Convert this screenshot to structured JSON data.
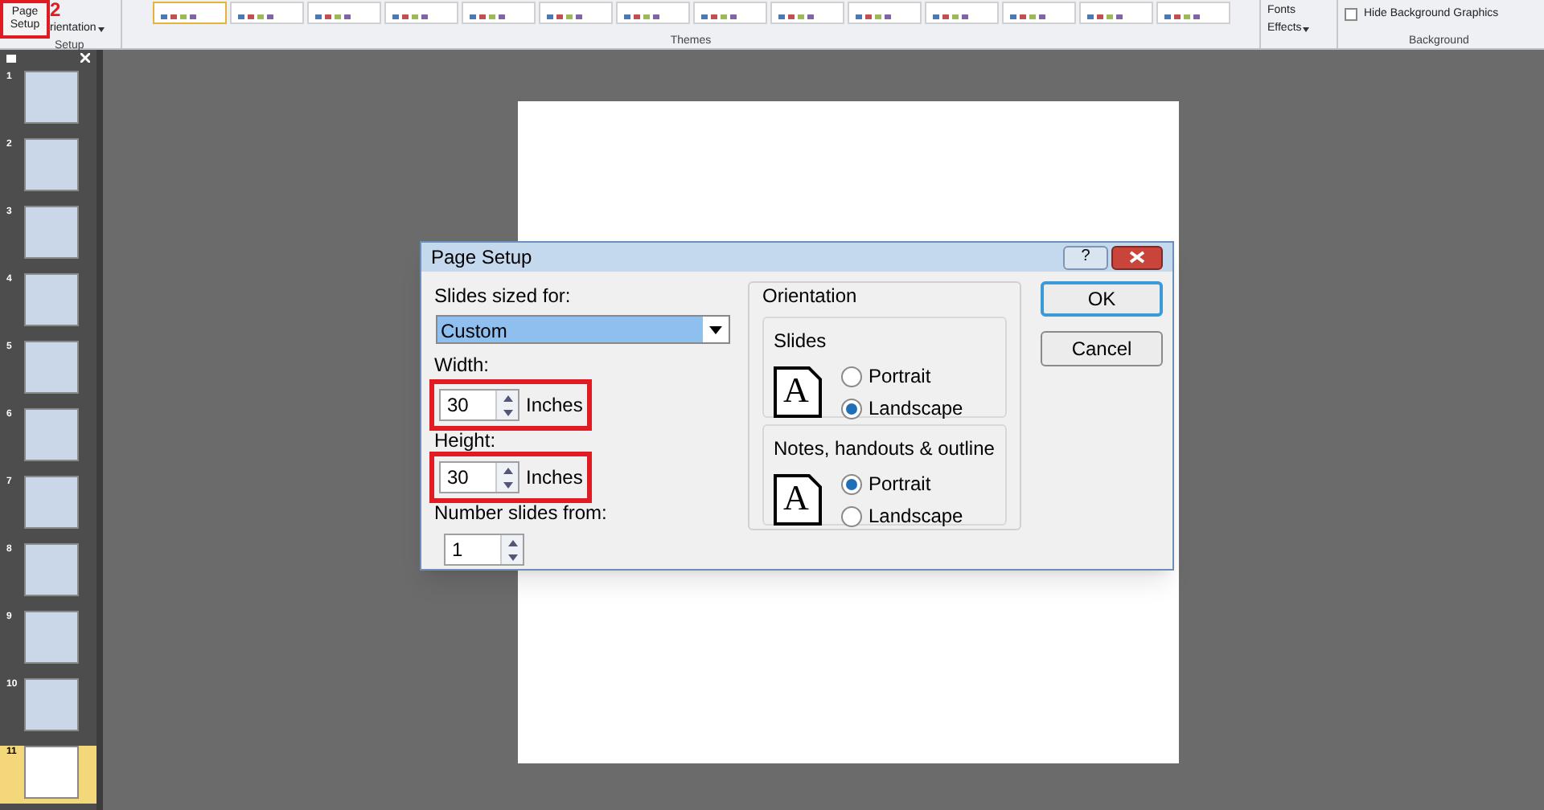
{
  "ribbon": {
    "page_setup_button": "Page Setup",
    "orientation_button": "rientation",
    "setup_group_label": "Setup",
    "annotation_number": "2",
    "themes": [
      {
        "selected": true
      },
      {
        "selected": false
      },
      {
        "selected": false
      },
      {
        "selected": false
      },
      {
        "selected": false
      },
      {
        "selected": false
      },
      {
        "selected": false
      },
      {
        "selected": false
      },
      {
        "selected": false
      },
      {
        "selected": false
      },
      {
        "selected": false
      },
      {
        "selected": false
      },
      {
        "selected": false
      },
      {
        "selected": false
      }
    ],
    "themes_label": "Themes",
    "fonts_button": "Fonts",
    "effects_button": "Effects",
    "hide_background_graphics": {
      "label": "Hide Background Graphics",
      "checked": false
    },
    "background_label": "Background"
  },
  "slides": [
    {
      "number": "1",
      "kind": "photo",
      "selected": false
    },
    {
      "number": "2",
      "kind": "photo",
      "selected": false
    },
    {
      "number": "3",
      "kind": "photo",
      "selected": false
    },
    {
      "number": "4",
      "kind": "photo",
      "selected": false
    },
    {
      "number": "5",
      "kind": "photo",
      "selected": false
    },
    {
      "number": "6",
      "kind": "photo",
      "selected": false
    },
    {
      "number": "7",
      "kind": "photo",
      "selected": false
    },
    {
      "number": "8",
      "kind": "photo",
      "selected": false
    },
    {
      "number": "9",
      "kind": "photo",
      "selected": false
    },
    {
      "number": "10",
      "kind": "photo",
      "selected": false
    },
    {
      "number": "11",
      "kind": "blank",
      "selected": true
    }
  ],
  "dialog": {
    "title": "Page Setup",
    "help_button": "?",
    "slides_sized_for": {
      "label": "Slides sized for:",
      "value": "Custom"
    },
    "width": {
      "label": "Width:",
      "value": "30",
      "unit": "Inches",
      "highlighted": true
    },
    "height": {
      "label": "Height:",
      "value": "30",
      "unit": "Inches",
      "highlighted": true
    },
    "number_slides_from": {
      "label": "Number slides from:",
      "value": "1"
    },
    "orientation": {
      "title": "Orientation",
      "groups": [
        {
          "title": "Slides",
          "icon_letter": "A",
          "options": [
            {
              "label": "Portrait",
              "selected": false
            },
            {
              "label": "Landscape",
              "selected": true
            }
          ]
        },
        {
          "title": "Notes, handouts & outline",
          "icon_letter": "A",
          "options": [
            {
              "label": "Portrait",
              "selected": true
            },
            {
              "label": "Landscape",
              "selected": false
            }
          ]
        }
      ]
    },
    "buttons": [
      "OK",
      "Cancel"
    ]
  }
}
